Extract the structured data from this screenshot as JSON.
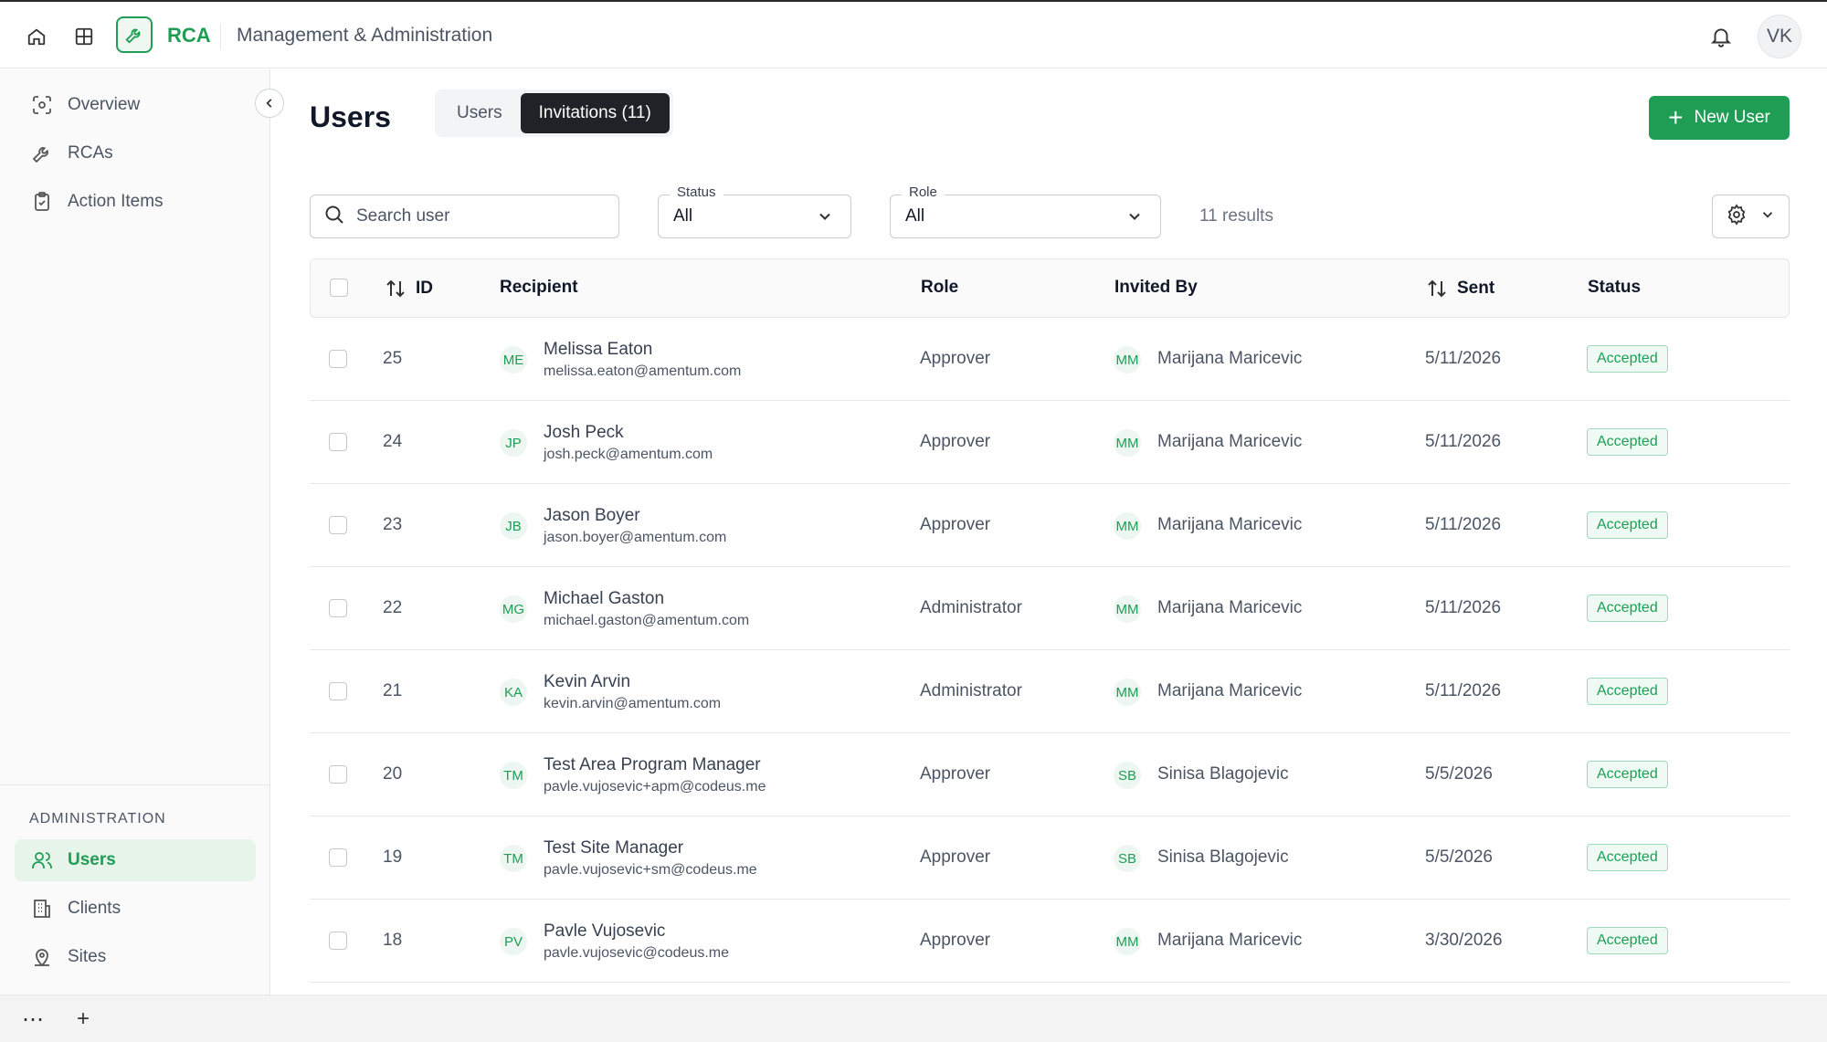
{
  "topbar": {
    "app_name": "RCA",
    "section": "Management & Administration",
    "user_initials": "VK"
  },
  "sidebar": {
    "items": [
      {
        "label": "Overview",
        "icon": "overview-icon"
      },
      {
        "label": "RCAs",
        "icon": "wrench-icon"
      },
      {
        "label": "Action Items",
        "icon": "clipboard-icon"
      }
    ],
    "admin_heading": "ADMINISTRATION",
    "admin_items": [
      {
        "label": "Users",
        "icon": "users-icon",
        "active": true
      },
      {
        "label": "Clients",
        "icon": "building-icon",
        "active": false
      },
      {
        "label": "Sites",
        "icon": "location-icon",
        "active": false
      }
    ]
  },
  "page": {
    "title": "Users",
    "tabs": [
      {
        "label": "Users",
        "active": false
      },
      {
        "label": "Invitations (11)",
        "active": true
      }
    ],
    "new_user_label": "New User"
  },
  "filters": {
    "search_placeholder": "Search user",
    "status_legend": "Status",
    "status_value": "All",
    "role_legend": "Role",
    "role_value": "All",
    "results": "11 results"
  },
  "table": {
    "columns": [
      "ID",
      "Recipient",
      "Role",
      "Invited By",
      "Sent",
      "Status"
    ],
    "rows": [
      {
        "id": "25",
        "initials": "ME",
        "name": "Melissa Eaton",
        "email": "melissa.eaton@amentum.com",
        "role": "Approver",
        "inviter_initials": "MM",
        "inviter": "Marijana Maricevic",
        "sent": "5/11/2026",
        "status": "Accepted"
      },
      {
        "id": "24",
        "initials": "JP",
        "name": "Josh Peck",
        "email": "josh.peck@amentum.com",
        "role": "Approver",
        "inviter_initials": "MM",
        "inviter": "Marijana Maricevic",
        "sent": "5/11/2026",
        "status": "Accepted"
      },
      {
        "id": "23",
        "initials": "JB",
        "name": "Jason Boyer",
        "email": "jason.boyer@amentum.com",
        "role": "Approver",
        "inviter_initials": "MM",
        "inviter": "Marijana Maricevic",
        "sent": "5/11/2026",
        "status": "Accepted"
      },
      {
        "id": "22",
        "initials": "MG",
        "name": "Michael Gaston",
        "email": "michael.gaston@amentum.com",
        "role": "Administrator",
        "inviter_initials": "MM",
        "inviter": "Marijana Maricevic",
        "sent": "5/11/2026",
        "status": "Accepted"
      },
      {
        "id": "21",
        "initials": "KA",
        "name": "Kevin Arvin",
        "email": "kevin.arvin@amentum.com",
        "role": "Administrator",
        "inviter_initials": "MM",
        "inviter": "Marijana Maricevic",
        "sent": "5/11/2026",
        "status": "Accepted"
      },
      {
        "id": "20",
        "initials": "TM",
        "name": "Test Area Program Manager",
        "email": "pavle.vujosevic+apm@codeus.me",
        "role": "Approver",
        "inviter_initials": "SB",
        "inviter": "Sinisa Blagojevic",
        "sent": "5/5/2026",
        "status": "Accepted"
      },
      {
        "id": "19",
        "initials": "TM",
        "name": "Test Site Manager",
        "email": "pavle.vujosevic+sm@codeus.me",
        "role": "Approver",
        "inviter_initials": "SB",
        "inviter": "Sinisa Blagojevic",
        "sent": "5/5/2026",
        "status": "Accepted"
      },
      {
        "id": "18",
        "initials": "PV",
        "name": "Pavle Vujosevic",
        "email": "pavle.vujosevic@codeus.me",
        "role": "Approver",
        "inviter_initials": "MM",
        "inviter": "Marijana Maricevic",
        "sent": "3/30/2026",
        "status": "Accepted"
      }
    ]
  },
  "bottombar": {
    "more_label": "⋯",
    "add_label": "+"
  },
  "colors": {
    "accent": "#1f9d55",
    "active_bg": "#e6f4ea",
    "tab_active": "#1f2328"
  }
}
